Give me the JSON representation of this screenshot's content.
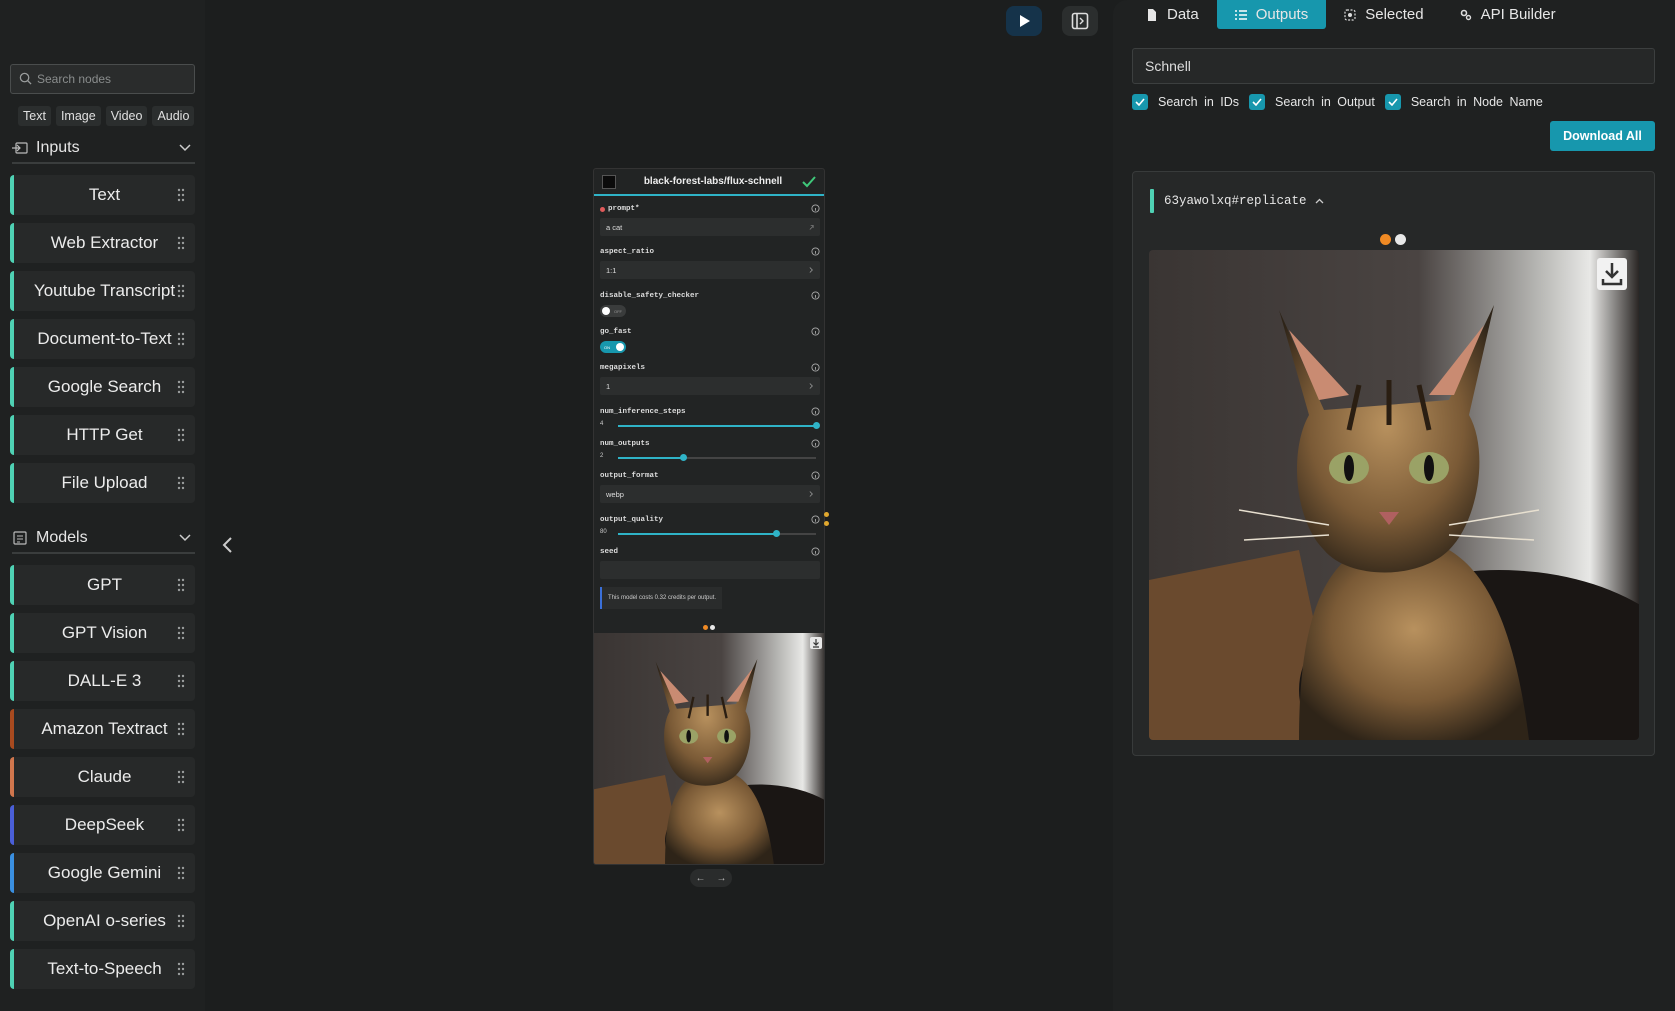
{
  "sidebar": {
    "search_placeholder": "Search nodes",
    "filters": [
      "Text",
      "Image",
      "Video",
      "Audio"
    ],
    "inputs_section": "Inputs",
    "inputs": [
      {
        "label": "Text",
        "color": "#4fd1b4"
      },
      {
        "label": "Web Extractor",
        "color": "#4fd1b4"
      },
      {
        "label": "Youtube Transcript",
        "color": "#4fd1b4"
      },
      {
        "label": "Document-to-Text",
        "color": "#4fd1b4"
      },
      {
        "label": "Google Search",
        "color": "#4fd1b4"
      },
      {
        "label": "HTTP Get",
        "color": "#4fd1b4"
      },
      {
        "label": "File Upload",
        "color": "#4fd1b4"
      }
    ],
    "models_section": "Models",
    "models": [
      {
        "label": "GPT",
        "color": "#4fd1b4"
      },
      {
        "label": "GPT Vision",
        "color": "#4fd1b4"
      },
      {
        "label": "DALL-E 3",
        "color": "#4fd1b4"
      },
      {
        "label": "Amazon Textract",
        "color": "#a84a1f"
      },
      {
        "label": "Claude",
        "color": "#d0764d"
      },
      {
        "label": "DeepSeek",
        "color": "#4a5fd8"
      },
      {
        "label": "Google Gemini",
        "color": "#3a8fe0"
      },
      {
        "label": "OpenAI o-series",
        "color": "#4fd1b4"
      },
      {
        "label": "Text-to-Speech",
        "color": "#4fd1b4"
      }
    ]
  },
  "node": {
    "title": "black-forest-labs/flux-schnell",
    "prompt_label": "prompt",
    "prompt_required": "*",
    "prompt_value": "a cat",
    "aspect_ratio_label": "aspect_ratio",
    "aspect_ratio_value": "1:1",
    "safety_label": "disable_safety_checker",
    "safety_state": "OFF",
    "go_fast_label": "go_fast",
    "go_fast_state": "ON",
    "megapixels_label": "megapixels",
    "megapixels_value": "1",
    "steps_label": "num_inference_steps",
    "steps_value": "4",
    "steps_fraction": 1.0,
    "outputs_label": "num_outputs",
    "outputs_value": "2",
    "outputs_fraction": 0.33,
    "format_label": "output_format",
    "format_value": "webp",
    "quality_label": "output_quality",
    "quality_value": "80",
    "quality_fraction": 0.8,
    "seed_label": "seed",
    "cost_note": "This model costs 0.32 credits per output.",
    "pager_prev": "←",
    "pager_next": "→"
  },
  "panel": {
    "tabs": [
      {
        "label": "Data",
        "icon": "file-icon"
      },
      {
        "label": "Outputs",
        "icon": "list-icon"
      },
      {
        "label": "Selected",
        "icon": "target-icon"
      },
      {
        "label": "API Builder",
        "icon": "gears-icon"
      }
    ],
    "active_tab": "Outputs",
    "search_value": "Schnell",
    "check_ids": "Search in IDs",
    "check_output": "Search in Output",
    "check_node_name": "Search in Node Name",
    "download_all": "Download All",
    "output_id": "63yawolxq#replicate"
  },
  "colors": {
    "accent": "#1797ad",
    "dot_active": "#f08a24",
    "dot_inactive": "#e8e8e8"
  }
}
